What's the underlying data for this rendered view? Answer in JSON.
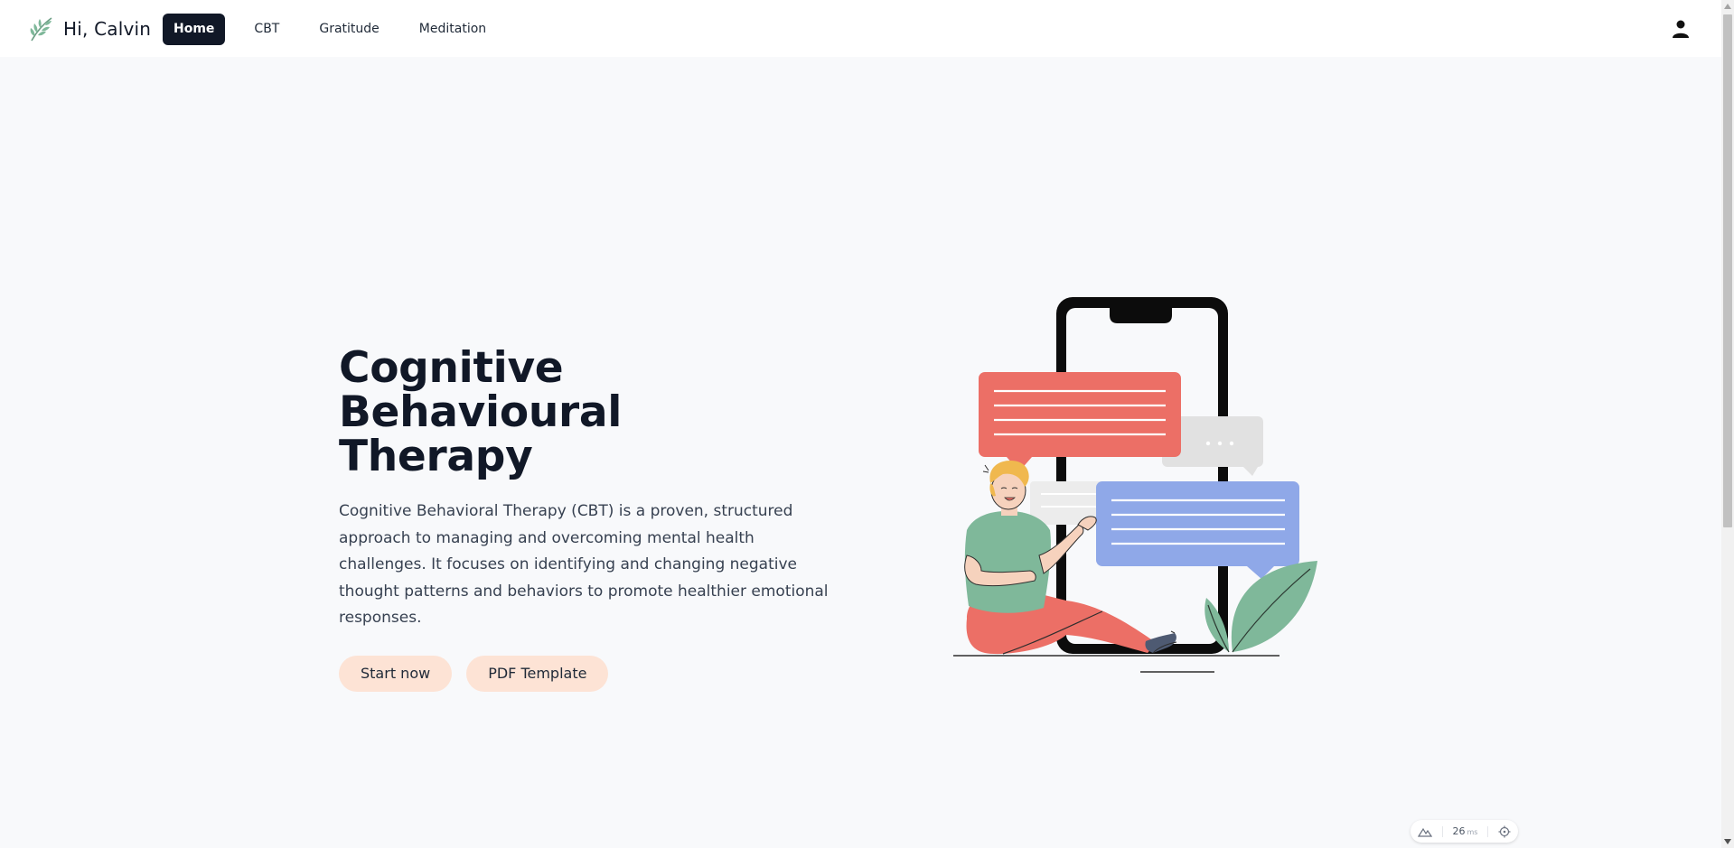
{
  "header": {
    "greeting": "Hi, Calvin",
    "logo_icon": "leaf-icon",
    "nav": [
      {
        "label": "Home",
        "active": true
      },
      {
        "label": "CBT",
        "active": false
      },
      {
        "label": "Gratitude",
        "active": false
      },
      {
        "label": "Meditation",
        "active": false
      }
    ],
    "user_icon": "user-icon"
  },
  "hero": {
    "title_line1": "Cognitive Behavioural",
    "title_line2": "Therapy",
    "description": "Cognitive Behavioral Therapy (CBT) is a proven, structured approach to managing and overcoming mental health challenges. It focuses on identifying and changing negative thought patterns and behaviors to promote healthier emotional responses.",
    "primary_button": "Start now",
    "secondary_button": "PDF Template",
    "illustration_icon": "phone-chat-illustration"
  },
  "perf_widget": {
    "value": "26",
    "unit": "ms"
  },
  "colors": {
    "nav_active_bg": "#111827",
    "button_bg": "#fde3d5",
    "page_bg": "#f8f9fb",
    "bubble_red": "#ec6f66",
    "bubble_blue": "#8fa8e8",
    "leaf_green": "#7fb89a"
  }
}
